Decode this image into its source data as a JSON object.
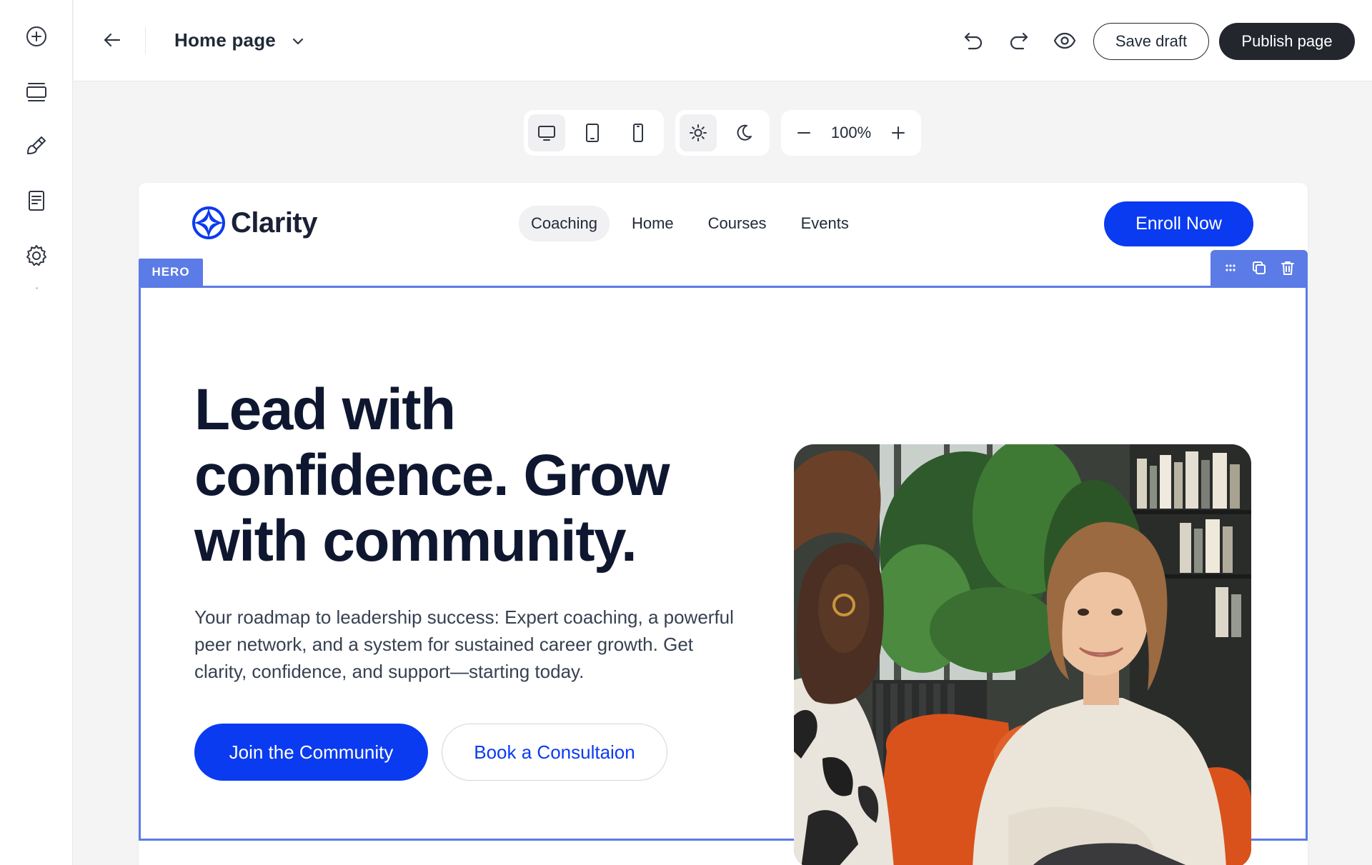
{
  "rail": {
    "items": [
      {
        "name": "add-icon"
      },
      {
        "name": "layers-icon"
      },
      {
        "name": "brush-icon"
      },
      {
        "name": "page-icon"
      },
      {
        "name": "gear-icon"
      }
    ]
  },
  "topbar": {
    "page_title": "Home page",
    "save_draft": "Save draft",
    "publish": "Publish page"
  },
  "toolbar": {
    "zoom": "100%",
    "devices": [
      "desktop",
      "tablet",
      "mobile"
    ],
    "active_device": "desktop",
    "themes": [
      "light",
      "dark"
    ],
    "active_theme": "light"
  },
  "site": {
    "logo_text": "Clarity",
    "nav": [
      "Coaching",
      "Home",
      "Courses",
      "Events"
    ],
    "active_nav": "Coaching",
    "cta": "Enroll Now"
  },
  "selection": {
    "section_tag": "HERO"
  },
  "hero": {
    "heading": "Lead with confidence. Grow with community.",
    "subtext": "Your roadmap to leadership success: Expert coaching, a powerful peer network, and a system for sustained career growth. Get clarity, confidence, and support—starting today.",
    "primary_button": "Join the Community",
    "secondary_button": "Book a Consultaion"
  },
  "colors": {
    "brand_blue": "#0b3bf0",
    "selection_blue": "#5b7be6",
    "dark_button": "#23262d",
    "heading": "#0f1730"
  }
}
